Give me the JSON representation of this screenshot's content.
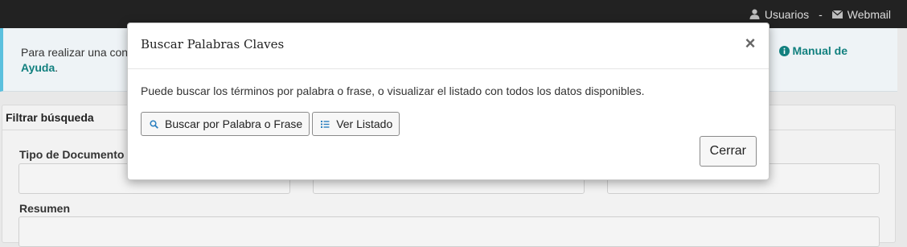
{
  "topbar": {
    "users_label": "Usuarios",
    "separator": "-",
    "webmail_label": "Webmail"
  },
  "info": {
    "text_prefix": "Para realizar una cons",
    "manual_link": "Manual de",
    "help_tail": "Ayuda",
    "period": "."
  },
  "filter": {
    "heading": "Filtrar búsqueda",
    "document_type_label": "Tipo de Documento",
    "summary_label": "Resumen"
  },
  "modal": {
    "title": "Buscar Palabras Claves",
    "close_glyph": "×",
    "description": "Puede buscar los términos por palabra o frase, o visualizar el listado con todos los datos disponibles.",
    "search_button": "Buscar por Palabra o Frase",
    "list_button": "Ver Listado",
    "dismiss_button": "Cerrar"
  },
  "colors": {
    "accent_teal": "#12807f",
    "info_border": "#5bc0de",
    "topbar_bg": "#222222"
  },
  "icons": [
    "user-icon",
    "mail-icon",
    "info-circle-icon",
    "search-icon",
    "list-icon",
    "close-icon",
    "caret-down-icon"
  ]
}
